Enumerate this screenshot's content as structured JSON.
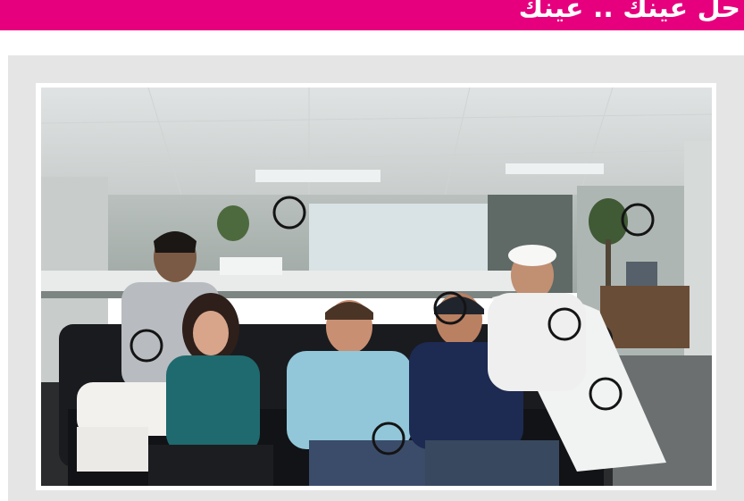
{
  "header": {
    "title": "حل عينك .. عينك",
    "background_color": "#e6007e",
    "text_color": "#ffffff"
  },
  "puzzle": {
    "panel_color": "#e5e5e5",
    "photo_description_icon": "office-group-photo",
    "difference_markers": [
      {
        "name": "difference-marker-1"
      },
      {
        "name": "difference-marker-2"
      },
      {
        "name": "difference-marker-3"
      },
      {
        "name": "difference-marker-4"
      },
      {
        "name": "difference-marker-5"
      },
      {
        "name": "difference-marker-6"
      },
      {
        "name": "difference-marker-7"
      }
    ]
  }
}
